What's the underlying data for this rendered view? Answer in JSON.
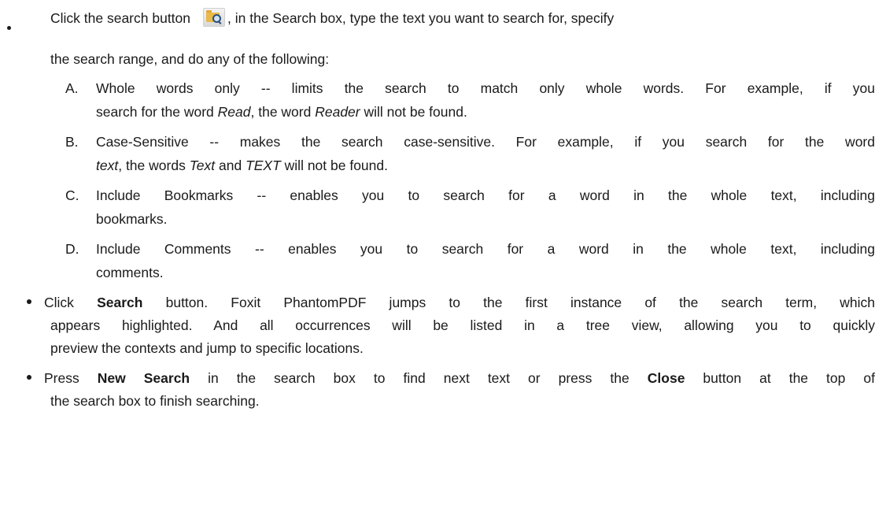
{
  "bullet1": {
    "text_before_icon": "Click the search button",
    "text_after_icon": ", in the Search box, type the text you want to search for, specify",
    "line2": "the search range, and do any of the following:"
  },
  "options": [
    {
      "letter": "A.",
      "line1": "Whole words only -- limits the search to match only whole words. For example, if you",
      "line2_a": "search for the word ",
      "line2_read": "Read",
      "line2_b": ", the word ",
      "line2_reader": "Reader",
      "line2_c": " will not be found."
    },
    {
      "letter": "B.",
      "line1": "Case-Sensitive -- makes the search case-sensitive. For example, if you search for the word",
      "line2_text": "text",
      "line2_a": ", the words ",
      "line2_Text": "Text",
      "line2_b": " and ",
      "line2_TEXT": "TEXT",
      "line2_c": " will not be found."
    },
    {
      "letter": "C.",
      "line1": "Include Bookmarks -- enables you to search for a word in the whole text, including",
      "line2": "bookmarks."
    },
    {
      "letter": "D.",
      "line1": "Include Comments -- enables you to search for a word in the whole text, including",
      "line2": "comments."
    }
  ],
  "bullet2": {
    "a": "Click ",
    "b_bold": "Search",
    "c": " button. Foxit PhantomPDF jumps to the first instance of the search term, which",
    "line2": "appears highlighted. And all occurrences will be listed in a tree view, allowing you to quickly",
    "line3": "preview the contexts and jump to specific locations."
  },
  "bullet3": {
    "a": "Press ",
    "b_bold": "New Search",
    "c": " in the search box to find next text or press the ",
    "d_bold": "Close",
    "e": " button at the top of",
    "line2": "the search box to finish searching."
  }
}
